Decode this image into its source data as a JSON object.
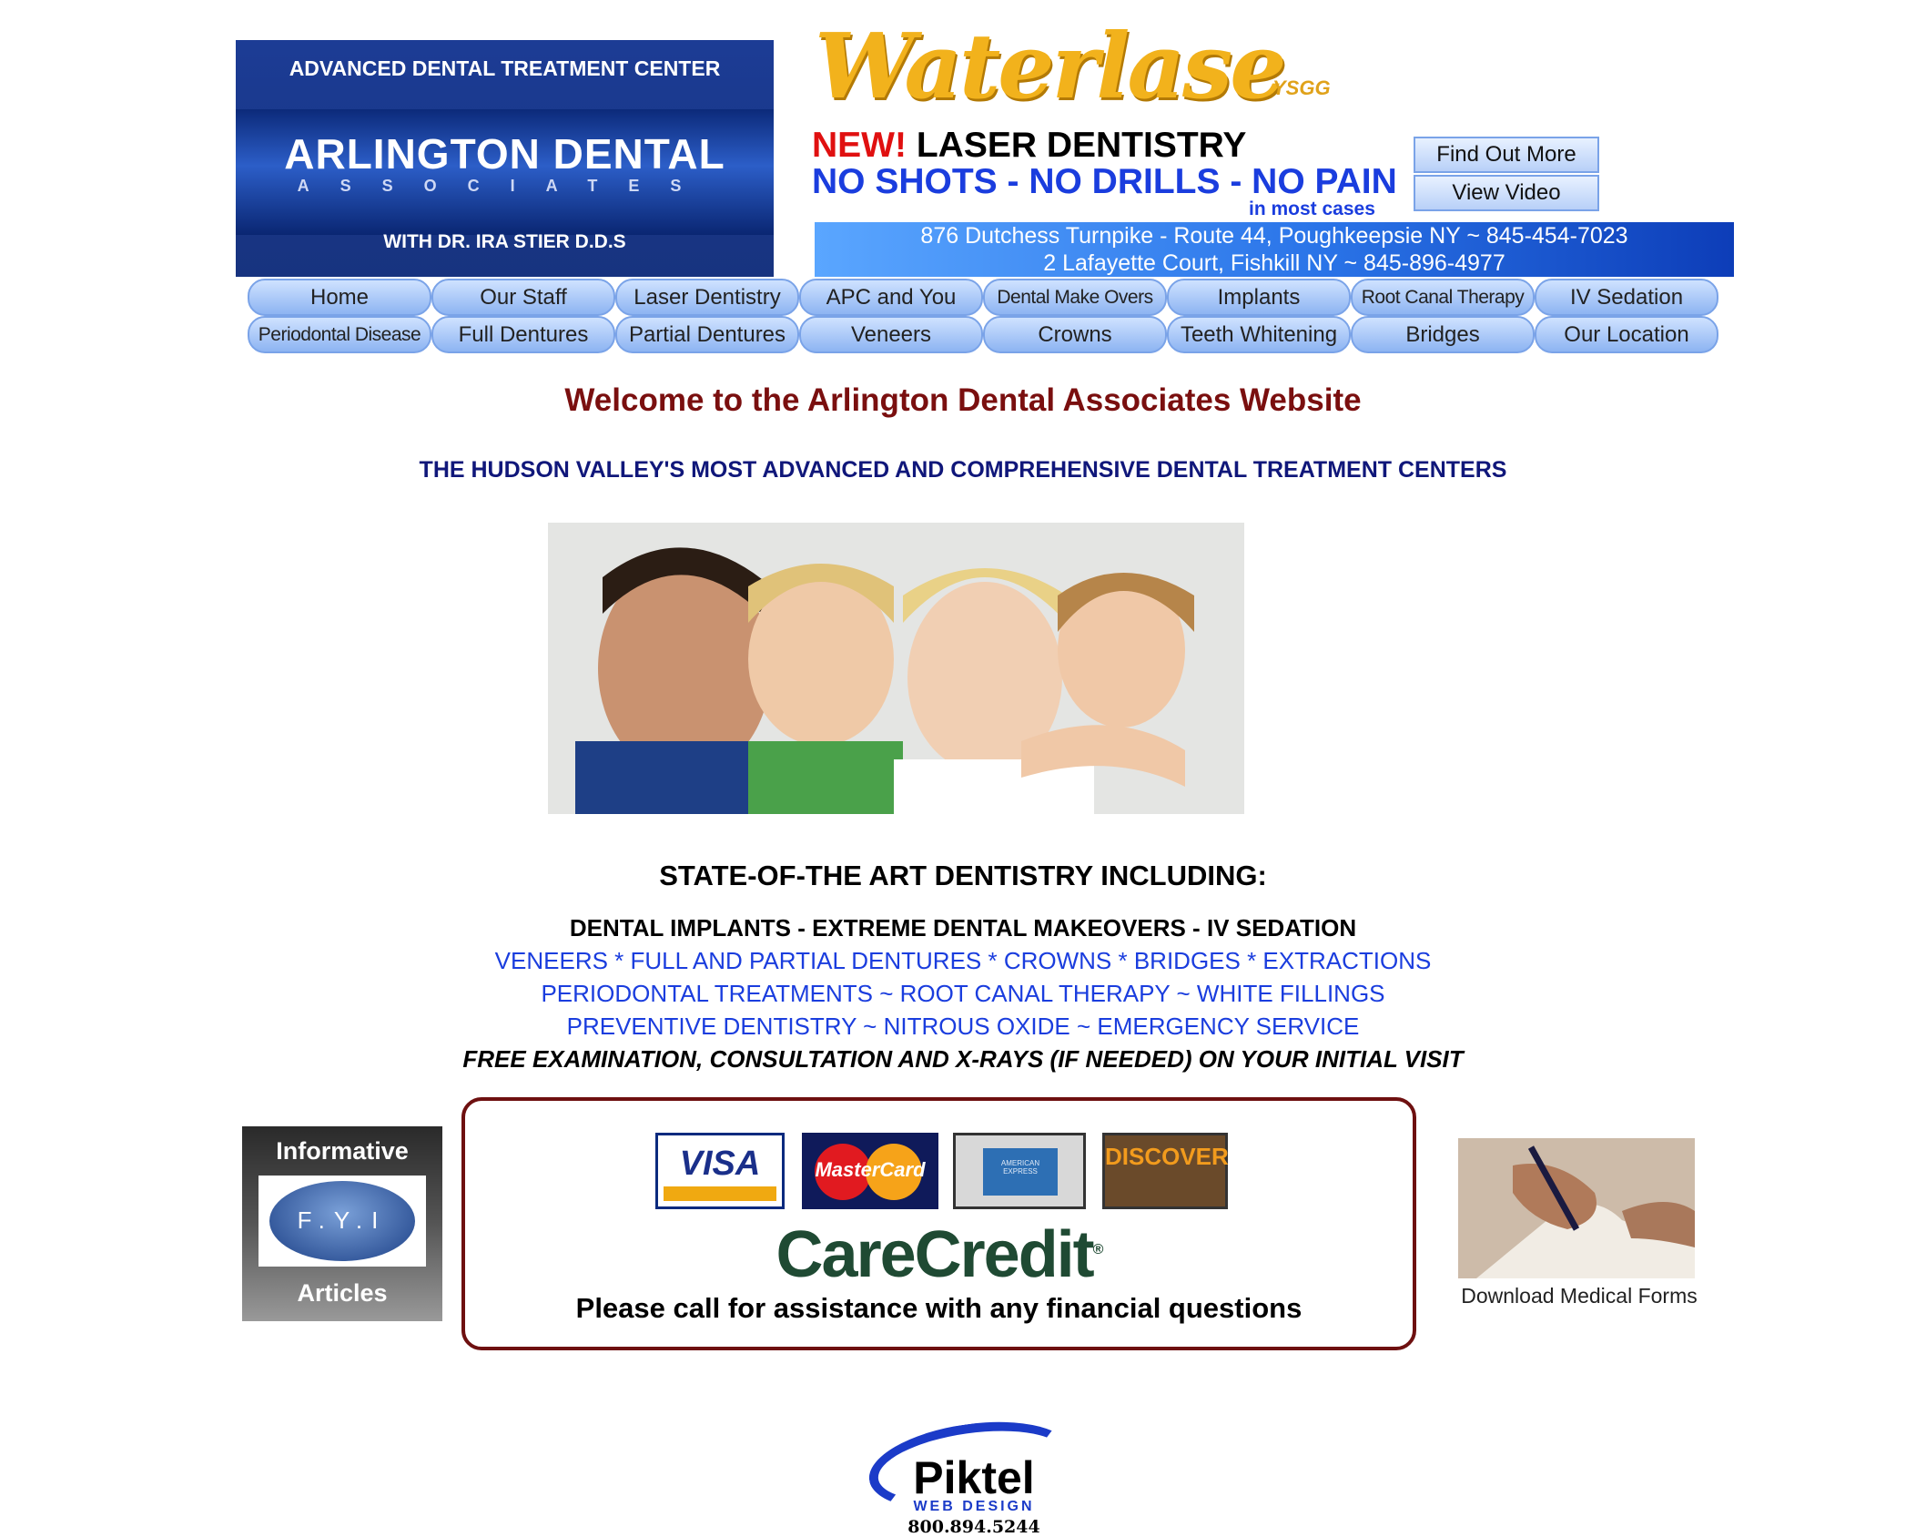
{
  "logo": {
    "top_text": "ADVANCED DENTAL TREATMENT CENTER",
    "name": "ARLINGTON DENTAL",
    "associates": "ASSOCIATES",
    "doctor": "WITH DR. IRA STIER D.D.S"
  },
  "promo": {
    "brand": "Waterlase",
    "brand_suffix": "YSGG",
    "new_label": "NEW!",
    "headline": "LASER DENTISTRY",
    "subheadline": "NO SHOTS - NO DRILLS - NO PAIN",
    "note": "in most cases",
    "find_out_label": "Find Out More",
    "view_video_label": "View Video"
  },
  "addresses": [
    "876 Dutchess Turnpike - Route 44, Poughkeepsie NY ~ 845-454-7023",
    "2 Lafayette Court, Fishkill NY ~ 845-896-4977"
  ],
  "nav": {
    "row1": [
      "Home",
      "Our Staff",
      "Laser Dentistry",
      "APC and You",
      "Dental Make Overs",
      "Implants",
      "Root Canal Therapy",
      "IV Sedation"
    ],
    "row2": [
      "Periodontal Disease",
      "Full Dentures",
      "Partial Dentures",
      "Veneers",
      "Crowns",
      "Teeth Whitening",
      "Bridges",
      "Our Location"
    ]
  },
  "main": {
    "welcome": "Welcome to the Arlington Dental Associates Website",
    "subtitle": "THE HUDSON VALLEY'S MOST ADVANCED AND COMPREHENSIVE DENTAL TREATMENT CENTERS",
    "state_heading": "STATE-OF-THE ART DENTISTRY INCLUDING:",
    "services": [
      "DENTAL IMPLANTS - EXTREME DENTAL MAKEOVERS - IV SEDATION",
      "VENEERS * FULL AND PARTIAL DENTURES * CROWNS * BRIDGES * EXTRACTIONS",
      "PERIODONTAL TREATMENTS ~ ROOT CANAL THERAPY ~ WHITE FILLINGS",
      "PREVENTIVE DENTISTRY ~ NITROUS OXIDE ~ EMERGENCY SERVICE",
      "FREE EXAMINATION, CONSULTATION AND X-RAYS (IF NEEDED) ON YOUR INITIAL VISIT"
    ]
  },
  "fyi": {
    "top": "Informative",
    "badge": "F.Y.I",
    "bottom": "Articles"
  },
  "payment": {
    "visa": "VISA",
    "mastercard": "MasterCard",
    "amex": "AMERICAN EXPRESS",
    "discover": "DISCOVER",
    "carecredit": "CareCredit",
    "message": "Please call for assistance with any financial questions"
  },
  "forms": {
    "label": "Download Medical Forms"
  },
  "footer": {
    "brand": "Piktel",
    "sub": "WEB DESIGN",
    "phone": "800.894.5244"
  },
  "colors": {
    "welcome": "#7a0f0f",
    "subtitle": "#10177a",
    "services_blue": "#1a3dde",
    "waterlase_gold": "#f2b21c",
    "payment_border": "#6e1010"
  }
}
